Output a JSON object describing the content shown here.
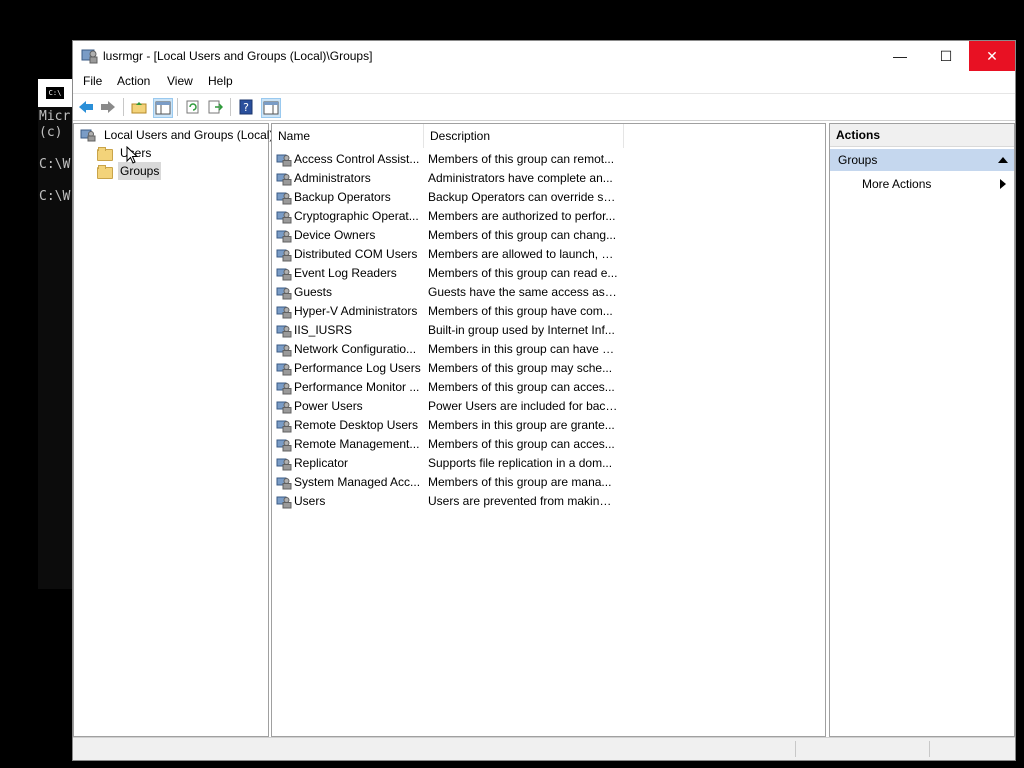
{
  "console": {
    "icon_text": "C:\\",
    "lines": [
      "Micr",
      "(c)",
      "",
      "C:\\W",
      "",
      "C:\\W"
    ]
  },
  "window": {
    "title": "lusrmgr - [Local Users and Groups (Local)\\Groups]",
    "min_glyph": "—",
    "max_glyph": "☐",
    "close_glyph": "✕"
  },
  "menu": [
    "File",
    "Action",
    "View",
    "Help"
  ],
  "tree": {
    "root": "Local Users and Groups (Local)",
    "children": [
      "Users",
      "Groups"
    ],
    "selected": "Groups"
  },
  "list": {
    "columns": [
      "Name",
      "Description"
    ],
    "rows": [
      {
        "name": "Access Control Assist...",
        "desc": "Members of this group can remot..."
      },
      {
        "name": "Administrators",
        "desc": "Administrators have complete an..."
      },
      {
        "name": "Backup Operators",
        "desc": "Backup Operators can override se..."
      },
      {
        "name": "Cryptographic Operat...",
        "desc": "Members are authorized to perfor..."
      },
      {
        "name": "Device Owners",
        "desc": "Members of this group can chang..."
      },
      {
        "name": "Distributed COM Users",
        "desc": "Members are allowed to launch, a..."
      },
      {
        "name": "Event Log Readers",
        "desc": "Members of this group can read e..."
      },
      {
        "name": "Guests",
        "desc": "Guests have the same access as m..."
      },
      {
        "name": "Hyper-V Administrators",
        "desc": "Members of this group have com..."
      },
      {
        "name": "IIS_IUSRS",
        "desc": "Built-in group used by Internet Inf..."
      },
      {
        "name": "Network Configuratio...",
        "desc": "Members in this group can have s..."
      },
      {
        "name": "Performance Log Users",
        "desc": "Members of this group may sche..."
      },
      {
        "name": "Performance Monitor ...",
        "desc": "Members of this group can acces..."
      },
      {
        "name": "Power Users",
        "desc": "Power Users are included for back..."
      },
      {
        "name": "Remote Desktop Users",
        "desc": "Members in this group are grante..."
      },
      {
        "name": "Remote Management...",
        "desc": "Members of this group can acces..."
      },
      {
        "name": "Replicator",
        "desc": "Supports file replication in a dom..."
      },
      {
        "name": "System Managed Acc...",
        "desc": "Members of this group are mana..."
      },
      {
        "name": "Users",
        "desc": "Users are prevented from making ..."
      }
    ]
  },
  "actions": {
    "header": "Actions",
    "section": "Groups",
    "items": [
      "More Actions"
    ]
  },
  "colors": {
    "close_button": "#e81123",
    "actions_section_bg": "#c5d7ee",
    "tree_selection": "#d9d9d9"
  }
}
